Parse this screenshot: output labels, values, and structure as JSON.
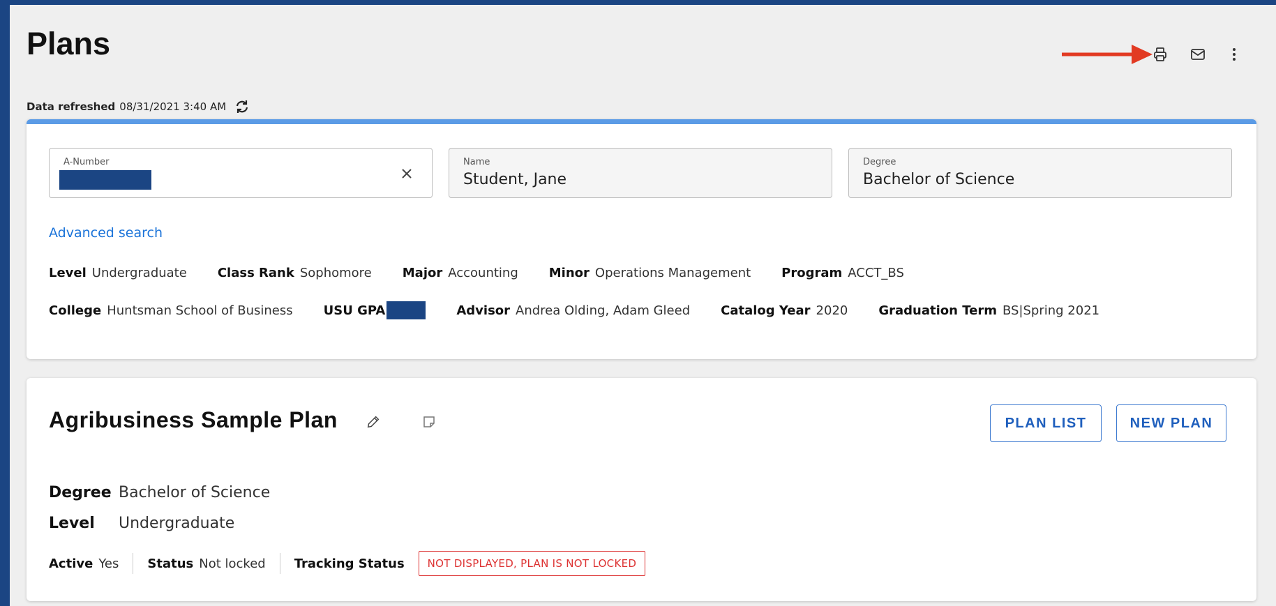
{
  "page": {
    "title": "Plans"
  },
  "header_actions": {
    "print_icon": "printer-icon",
    "mail_icon": "mail-icon",
    "more_icon": "more-vert-icon"
  },
  "refresh": {
    "label": "Data refreshed",
    "timestamp": "08/31/2021 3:40 AM"
  },
  "search": {
    "a_number": {
      "label": "A-Number",
      "value": ""
    },
    "name": {
      "label": "Name",
      "value": "Student, Jane"
    },
    "degree": {
      "label": "Degree",
      "value": "Bachelor of Science"
    },
    "advanced_link": "Advanced search"
  },
  "student": {
    "row1": [
      {
        "key": "Level",
        "value": "Undergraduate"
      },
      {
        "key": "Class Rank",
        "value": "Sophomore"
      },
      {
        "key": "Major",
        "value": "Accounting"
      },
      {
        "key": "Minor",
        "value": "Operations Management"
      },
      {
        "key": "Program",
        "value": "ACCT_BS"
      }
    ],
    "row2": [
      {
        "key": "College",
        "value": "Huntsman School of Business"
      },
      {
        "key": "USU GPA",
        "value": ""
      },
      {
        "key": "Advisor",
        "value": "Andrea Olding, Adam Gleed"
      },
      {
        "key": "Catalog Year",
        "value": "2020"
      },
      {
        "key": "Graduation Term",
        "value": "BS|Spring 2021"
      }
    ]
  },
  "plan": {
    "title": "Agribusiness Sample Plan",
    "buttons": {
      "plan_list": "PLAN LIST",
      "new_plan": "NEW PLAN"
    },
    "degree": {
      "key": "Degree",
      "value": "Bachelor of Science"
    },
    "level": {
      "key": "Level",
      "value": "Undergraduate"
    },
    "active": {
      "key": "Active",
      "value": "Yes"
    },
    "status": {
      "key": "Status",
      "value": "Not locked"
    },
    "tracking": {
      "key": "Tracking Status",
      "value": "NOT DISPLAYED, PLAN IS NOT LOCKED"
    }
  },
  "colors": {
    "frame": "#1b4583",
    "accent": "#5b9be6",
    "link": "#1a73d9",
    "alert": "#dd3333",
    "arrow": "#e23a22"
  }
}
